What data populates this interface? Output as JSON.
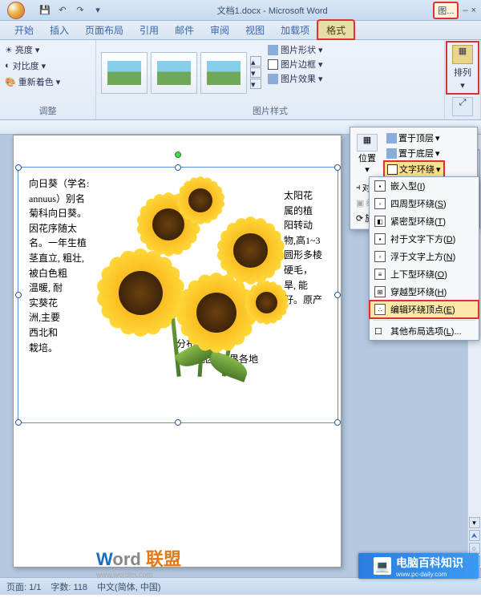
{
  "title": "文档1.docx - Microsoft Word",
  "tool_context": "图...",
  "qat": [
    "save",
    "undo",
    "redo",
    "open"
  ],
  "win": {
    "min": "–",
    "restore": "□",
    "close": "×"
  },
  "tabs": [
    "开始",
    "插入",
    "页面布局",
    "引用",
    "邮件",
    "审阅",
    "视图",
    "加载项",
    "格式"
  ],
  "active_tab": "格式",
  "ribbon": {
    "adjust": {
      "brightness": "亮度",
      "contrast": "对比度",
      "recolor": "重新着色",
      "label": "调整"
    },
    "styles": {
      "shape": "图片形状",
      "border": "图片边框",
      "effects": "图片效果",
      "label": "图片样式"
    },
    "arrange": {
      "arrange_btn": "排列",
      "size_btn": "大小"
    }
  },
  "flyout": {
    "position": "位置",
    "front": "置于顶层",
    "back": "置于底层",
    "wrap": "文字环绕",
    "align": "对齐",
    "group": "组合",
    "rotate": "旋转"
  },
  "wrap_menu": [
    {
      "label": "嵌入型",
      "accel": "I"
    },
    {
      "label": "四周型环绕",
      "accel": "S"
    },
    {
      "label": "紧密型环绕",
      "accel": "T"
    },
    {
      "label": "衬于文字下方",
      "accel": "D"
    },
    {
      "label": "浮于文字上方",
      "accel": "N"
    },
    {
      "label": "上下型环绕",
      "accel": "O"
    },
    {
      "label": "穿越型环绕",
      "accel": "H"
    },
    {
      "label": "编辑环绕顶点",
      "accel": "E"
    },
    {
      "label": "其他布局选项",
      "accel": "L"
    }
  ],
  "wrap_highlight": 7,
  "doc_text_left": "向日葵（学名:\nannuus）别名\n菊科向日葵。\n因花序随太\n名。一年生植\n茎直立, 粗壮,\n被白色粗\n温暖, 耐\n实葵花\n洲,主要\n西北和\n栽培。",
  "doc_text_right": "太阳花\n属的植\n阳转动\n物,高1~3\n圆形多棱\n硬毛，\n旱, 能\n籽。原产",
  "doc_text_bottom": "分布在我国东\n华北地区, 世界各地",
  "watermark": {
    "word": "Word",
    "cn": "联盟",
    "url": "www.wordlm.com"
  },
  "logo_overlay": "电脑百科知识",
  "logo_url": "www.pc-daily.com",
  "status": {
    "page": "页面: 1/1",
    "words": "字数: 118",
    "lang": "中文(简体, 中国)"
  }
}
